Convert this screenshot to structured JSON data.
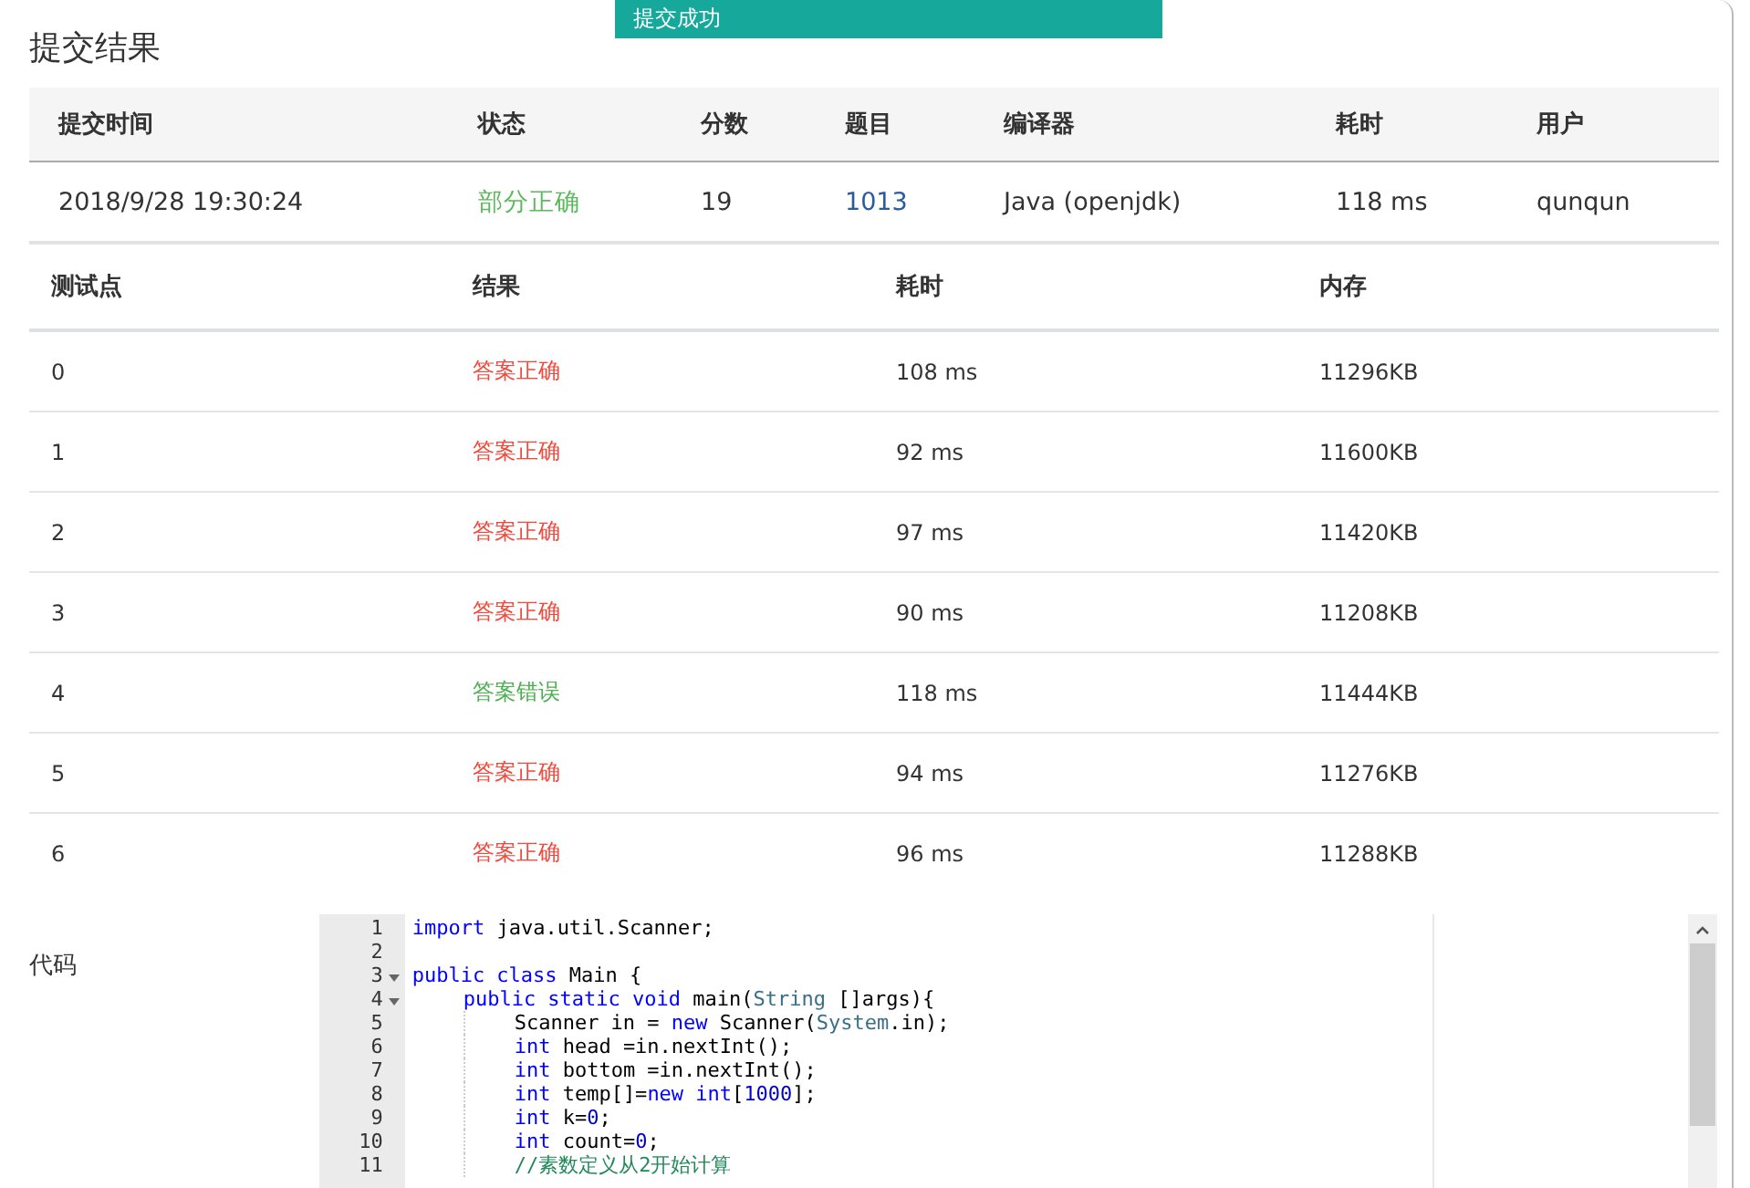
{
  "toast": {
    "text": "提交成功"
  },
  "title": "提交结果",
  "summary": {
    "columns": [
      "提交时间",
      "状态",
      "分数",
      "题目",
      "编译器",
      "耗时",
      "用户"
    ],
    "row": {
      "time": "2018/9/28 19:30:24",
      "status": "部分正确",
      "kind": "partial",
      "score": "19",
      "problem": "1013",
      "compiler": "Java (openjdk)",
      "elapsed": "118 ms",
      "user": "qunqun"
    }
  },
  "tests": {
    "columns": [
      "测试点",
      "结果",
      "耗时",
      "内存"
    ],
    "rows": [
      {
        "case": "0",
        "result": "答案正确",
        "color": "#f2473a",
        "time": "108 ms",
        "memory": "11296KB"
      },
      {
        "case": "1",
        "result": "答案正确",
        "color": "#f2473a",
        "time": "92 ms",
        "memory": "11600KB"
      },
      {
        "case": "2",
        "result": "答案正确",
        "color": "#f2473a",
        "time": "97 ms",
        "memory": "11420KB"
      },
      {
        "case": "3",
        "result": "答案正确",
        "color": "#f2473a",
        "time": "90 ms",
        "memory": "11208KB"
      },
      {
        "case": "4",
        "result": "答案错误",
        "color": "#4caf50",
        "time": "118 ms",
        "memory": "11444KB"
      },
      {
        "case": "5",
        "result": "答案正确",
        "color": "#f2473a",
        "time": "94 ms",
        "memory": "11276KB"
      },
      {
        "case": "6",
        "result": "答案正确",
        "color": "#f2473a",
        "time": "96 ms",
        "memory": "11288KB"
      }
    ]
  },
  "code": {
    "label": "代码",
    "lines": [
      {
        "number": "1",
        "fold": false,
        "tokens": [
          {
            "kind": "keyword",
            "text": "import"
          },
          {
            "kind": "plain",
            "text": " java.util.Scanner;"
          }
        ]
      },
      {
        "number": "2",
        "fold": false
      },
      {
        "number": "3",
        "fold": true,
        "tokens": [
          {
            "kind": "keyword",
            "text": "public class"
          },
          {
            "kind": "plain",
            "text": " Main {"
          }
        ],
        "children": [
          {
            "number": "4",
            "fold": true,
            "tokens": [
              {
                "kind": "keyword",
                "text": "public static void"
              },
              {
                "kind": "plain",
                "text": " main("
              },
              {
                "kind": "type",
                "text": "String"
              },
              {
                "kind": "plain",
                "text": " []args){"
              }
            ],
            "children": [
              {
                "number": "5",
                "fold": false,
                "tokens": [
                  {
                    "kind": "plain",
                    "text": "Scanner in = "
                  },
                  {
                    "kind": "keyword",
                    "text": "new"
                  },
                  {
                    "kind": "plain",
                    "text": " Scanner("
                  },
                  {
                    "kind": "type",
                    "text": "System"
                  },
                  {
                    "kind": "plain",
                    "text": ".in);"
                  }
                ]
              },
              {
                "number": "6",
                "fold": false,
                "tokens": [
                  {
                    "kind": "keyword",
                    "text": "int"
                  },
                  {
                    "kind": "plain",
                    "text": " head =in.nextInt();"
                  }
                ]
              },
              {
                "number": "7",
                "fold": false,
                "tokens": [
                  {
                    "kind": "keyword",
                    "text": "int"
                  },
                  {
                    "kind": "plain",
                    "text": " bottom =in.nextInt();"
                  }
                ]
              },
              {
                "number": "8",
                "fold": false,
                "tokens": [
                  {
                    "kind": "keyword",
                    "text": "int"
                  },
                  {
                    "kind": "plain",
                    "text": " temp[]="
                  },
                  {
                    "kind": "keyword",
                    "text": "new int"
                  },
                  {
                    "kind": "plain",
                    "text": "["
                  },
                  {
                    "kind": "number",
                    "text": "1000"
                  },
                  {
                    "kind": "plain",
                    "text": "];"
                  }
                ]
              },
              {
                "number": "9",
                "fold": false,
                "tokens": [
                  {
                    "kind": "keyword",
                    "text": "int"
                  },
                  {
                    "kind": "plain",
                    "text": " k="
                  },
                  {
                    "kind": "number",
                    "text": "0"
                  },
                  {
                    "kind": "plain",
                    "text": ";"
                  }
                ]
              },
              {
                "number": "10",
                "fold": false,
                "tokens": [
                  {
                    "kind": "keyword",
                    "text": "int"
                  },
                  {
                    "kind": "plain",
                    "text": " count="
                  },
                  {
                    "kind": "number",
                    "text": "0"
                  },
                  {
                    "kind": "plain",
                    "text": ";"
                  }
                ]
              },
              {
                "number": "11",
                "fold": false,
                "tokens": [
                  {
                    "kind": "comment",
                    "text": "//素数定义从2开始计算"
                  }
                ]
              }
            ]
          }
        ]
      }
    ]
  }
}
